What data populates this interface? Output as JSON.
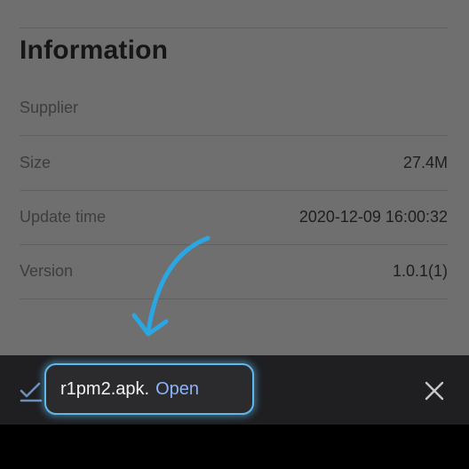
{
  "section": {
    "title": "Information"
  },
  "info": {
    "rows": [
      {
        "label": "Supplier",
        "value": ""
      },
      {
        "label": "Size",
        "value": "27.4M"
      },
      {
        "label": "Update time",
        "value": "2020-12-09 16:00:32"
      },
      {
        "label": "Version",
        "value": "1.0.1(1)"
      }
    ]
  },
  "download": {
    "filename": "r1pm2.apk.",
    "open_label": "Open"
  },
  "icons": {
    "status": "download-done-icon",
    "close": "close-icon",
    "annotation": "curved-arrow-icon"
  },
  "colors": {
    "accent": "#5fb8ea",
    "link": "#8ab4f8",
    "dimmed_background": "#6f6f6f",
    "download_bar": "#1f1f22"
  }
}
